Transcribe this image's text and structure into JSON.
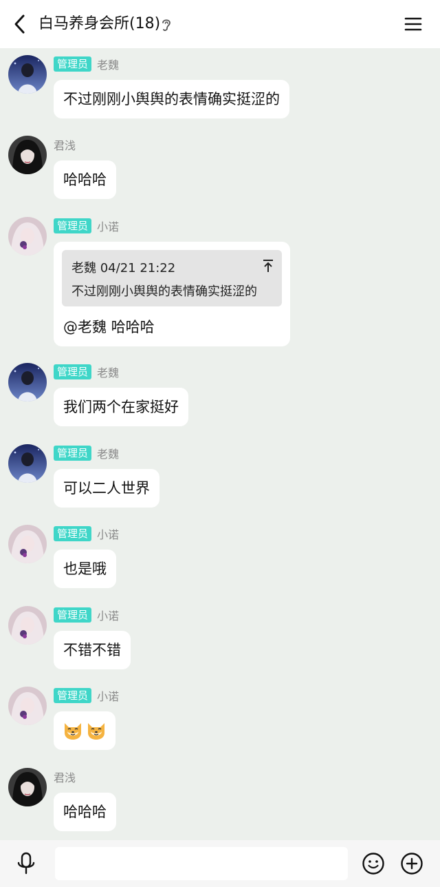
{
  "header": {
    "title": "白马养身会所(18)",
    "back_icon": "chevron-left-icon",
    "ear_icon": "ear-icon",
    "menu_icon": "hamburger-menu-icon"
  },
  "messages": [
    {
      "badge": "管理员",
      "name": "老魏",
      "text": "不过刚刚小舆舆的表情确实挺涩的"
    },
    {
      "badge": "",
      "name": "君浅",
      "text": "哈哈哈"
    },
    {
      "badge": "管理员",
      "name": "小诺",
      "quote_meta": "老魏 04/21 21:22",
      "quote_text": "不过刚刚小舆舆的表情确实挺涩的",
      "text": "@老魏 哈哈哈"
    },
    {
      "badge": "管理员",
      "name": "老魏",
      "text": "我们两个在家挺好"
    },
    {
      "badge": "管理员",
      "name": "老魏",
      "text": "可以二人世界"
    },
    {
      "badge": "管理员",
      "name": "小诺",
      "text": "也是哦"
    },
    {
      "badge": "管理员",
      "name": "小诺",
      "text": "不错不错"
    },
    {
      "badge": "管理员",
      "name": "小诺",
      "stickers": [
        "shiba-face-sticker",
        "shiba-face-sticker"
      ]
    },
    {
      "badge": "",
      "name": "君浅",
      "text": "哈哈哈"
    }
  ],
  "footer": {
    "mic_icon": "microphone-icon",
    "input_value": "",
    "emoji_icon": "smiley-icon",
    "plus_icon": "plus-circle-icon"
  },
  "colors": {
    "background": "#ecf0ec",
    "badge": "#3fd6c8",
    "bubble": "#ffffff"
  }
}
